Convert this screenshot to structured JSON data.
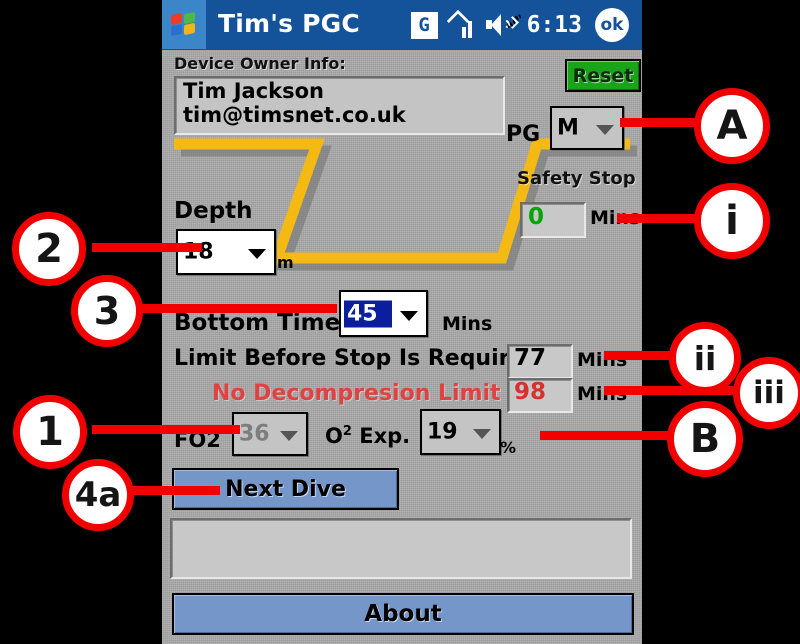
{
  "window": {
    "title": "Tim's PGC",
    "start_icon": "windows-flag-icon",
    "ok_label": "ok",
    "status": {
      "gprs_label": "G",
      "signal_icon": "signal-bars-icon",
      "volume_icon": "speaker-icon",
      "time": "6:13"
    }
  },
  "form": {
    "owner_label": "Device Owner Info:",
    "owner_name": "Tim Jackson",
    "owner_email": "tim@timsnet.co.uk",
    "reset_label": "Reset",
    "pg_label": "PG",
    "pg_value": "M",
    "depth_label": "Depth",
    "depth_value": "18",
    "depth_unit": "m",
    "safety_stop_label": "Safety Stop",
    "safety_stop_value": "0",
    "safety_stop_unit": "Mins",
    "bottom_time_label": "Bottom Time",
    "bottom_time_value": "45",
    "bottom_time_unit": "Mins",
    "limit_label": "Limit Before Stop Is Requird",
    "limit_value": "77",
    "limit_unit": "Mins",
    "ndl_label": "No Decompresion Limit",
    "ndl_value": "98",
    "ndl_unit": "Mins",
    "fo2_label": "FO2",
    "fo2_value": "36",
    "o2exp_label_main": "O",
    "o2exp_label_sup": "2",
    "o2exp_label_rest": " Exp.",
    "o2exp_value": "19",
    "o2exp_unit": "%",
    "next_dive_label": "Next Dive",
    "about_label": "About",
    "message_value": ""
  },
  "colors": {
    "titlebar": "#14539a",
    "panel": "#a9a9a9",
    "profile_line": "#f5b914",
    "button": "#7596c8",
    "reset": "#19a419",
    "ndl_text": "#e04242",
    "safety_value": "#00a400",
    "annotation": "#f20000"
  },
  "annotations": [
    {
      "id": "2",
      "label": "2",
      "side": "left"
    },
    {
      "id": "3",
      "label": "3",
      "side": "left"
    },
    {
      "id": "1",
      "label": "1",
      "side": "left"
    },
    {
      "id": "4a",
      "label": "4a",
      "side": "left"
    },
    {
      "id": "A",
      "label": "A",
      "side": "right"
    },
    {
      "id": "i",
      "label": "i",
      "side": "right"
    },
    {
      "id": "ii",
      "label": "ii",
      "side": "right"
    },
    {
      "id": "iii",
      "label": "iii",
      "side": "right"
    },
    {
      "id": "B",
      "label": "B",
      "side": "right"
    }
  ]
}
